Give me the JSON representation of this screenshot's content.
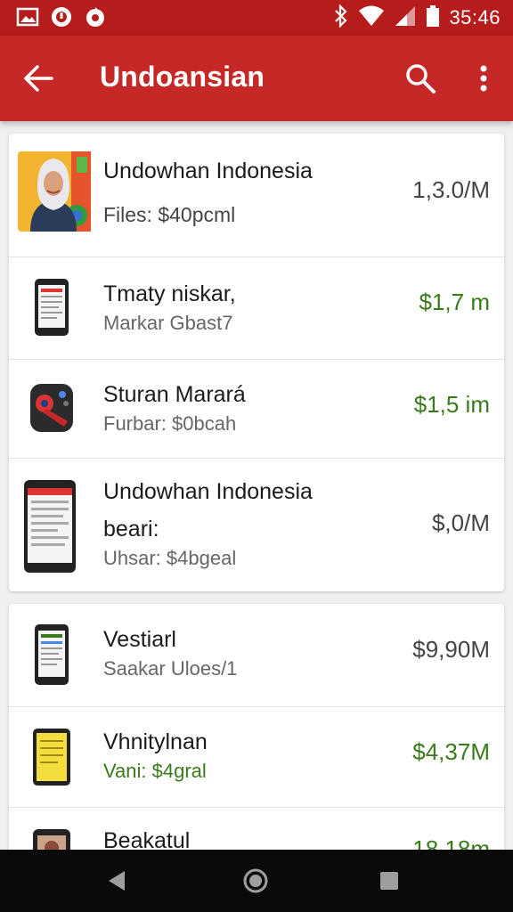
{
  "status_bar": {
    "time": "35:46"
  },
  "app_bar": {
    "title": "Undoansian"
  },
  "list_items": [
    {
      "name": "Undowhan Indonesia",
      "sub": "Files:   $40pcml",
      "price": "1,3.0/M"
    },
    {
      "name": "Tmaty niskar,",
      "sub": "Markar  Gbast7",
      "price": "$1,7 m"
    },
    {
      "name": "Sturan Marará",
      "sub": "Furbar:  $0bcah",
      "price": "$1,5 im"
    },
    {
      "name": "Undowhan Indonesia",
      "name2": "beari:",
      "sub": "Uhsar:  $4bgeal",
      "price": "$,0/M"
    },
    {
      "name": "Vestiarl",
      "sub": "Saakar  Uloes/1",
      "price": "$9,90M"
    },
    {
      "name": "Vhnitylnan",
      "sub": "Vani:   $4gral",
      "price": "$4,37M"
    },
    {
      "name": "Beakatul",
      "price": "18,18m"
    }
  ],
  "colors": {
    "status_bar": "#b71c1c",
    "app_bar": "#c62828",
    "green_price": "#3b7a1a"
  },
  "icons": {
    "status_left": [
      "image-icon",
      "alert-icon",
      "app-notification-icon"
    ],
    "status_right": [
      "bluetooth-icon",
      "wifi-icon",
      "signal-icon",
      "battery-icon"
    ],
    "app_bar": [
      "back-arrow-icon",
      "search-icon",
      "more-vert-icon"
    ],
    "nav": [
      "back-triangle-icon",
      "home-circle-icon",
      "recents-square-icon"
    ]
  }
}
